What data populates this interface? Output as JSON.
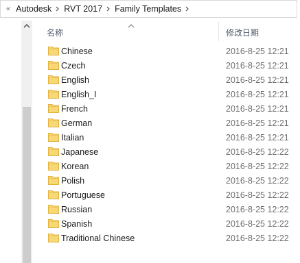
{
  "address_bar": {
    "overflow": "«",
    "crumbs": [
      "Autodesk",
      "RVT 2017",
      "Family Templates"
    ]
  },
  "columns": {
    "name": "名称",
    "modified": "修改日期"
  },
  "rows": [
    {
      "name": "Chinese",
      "date": "2016-8-25 12:21"
    },
    {
      "name": "Czech",
      "date": "2016-8-25 12:21"
    },
    {
      "name": "English",
      "date": "2016-8-25 12:21"
    },
    {
      "name": "English_I",
      "date": "2016-8-25 12:21"
    },
    {
      "name": "French",
      "date": "2016-8-25 12:21"
    },
    {
      "name": "German",
      "date": "2016-8-25 12:21"
    },
    {
      "name": "Italian",
      "date": "2016-8-25 12:21"
    },
    {
      "name": "Japanese",
      "date": "2016-8-25 12:22"
    },
    {
      "name": "Korean",
      "date": "2016-8-25 12:22"
    },
    {
      "name": "Polish",
      "date": "2016-8-25 12:22"
    },
    {
      "name": "Portuguese",
      "date": "2016-8-25 12:22"
    },
    {
      "name": "Russian",
      "date": "2016-8-25 12:22"
    },
    {
      "name": "Spanish",
      "date": "2016-8-25 12:22"
    },
    {
      "name": "Traditional Chinese",
      "date": "2016-8-25 12:22"
    }
  ],
  "icons": {
    "folder": "folder-icon",
    "separator": "chevron-right-icon",
    "sort": "sort-ascending-icon",
    "scroll_up": "scroll-up-arrow-icon"
  },
  "colors": {
    "folder_fill": "#f8d775",
    "folder_tab": "#e8b84a",
    "header_text": "#4d5a6a",
    "date_text": "#6d6d6d"
  }
}
